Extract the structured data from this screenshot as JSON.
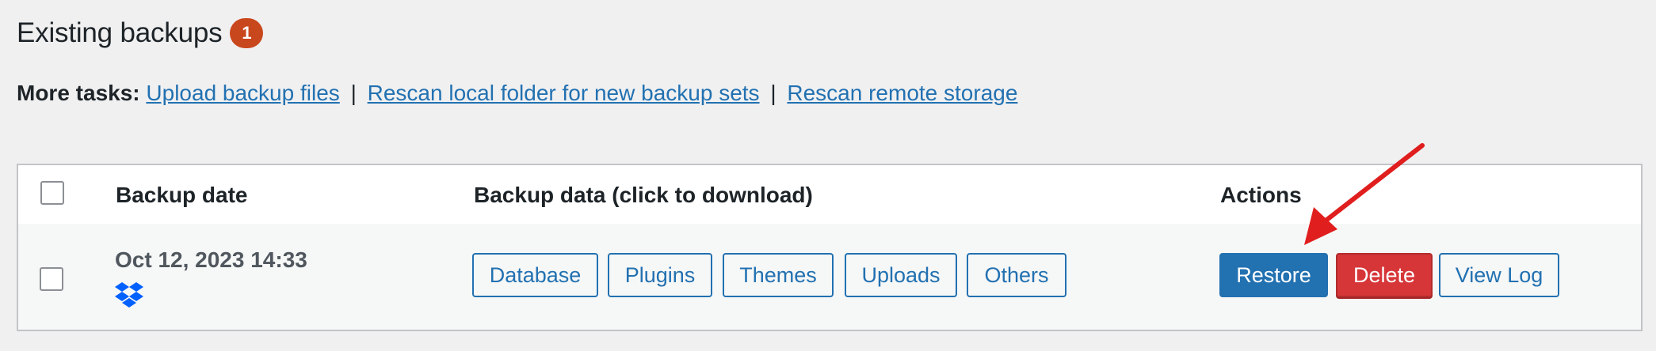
{
  "heading": {
    "title": "Existing backups",
    "count": "1"
  },
  "more_tasks": {
    "label": "More tasks:",
    "links": [
      "Upload backup files",
      "Rescan local folder for new backup sets",
      "Rescan remote storage"
    ],
    "separator": "|"
  },
  "table": {
    "columns": [
      "Backup date",
      "Backup data (click to download)",
      "Actions"
    ],
    "rows": [
      {
        "date": "Oct 12, 2023 14:33",
        "storage_icon": "dropbox-icon",
        "data_buttons": [
          "Database",
          "Plugins",
          "Themes",
          "Uploads",
          "Others"
        ],
        "actions": [
          "Restore",
          "Delete",
          "View Log"
        ]
      }
    ]
  },
  "colors": {
    "accent": "#2271b1",
    "danger": "#d63638",
    "badge": "#c9471c",
    "annotation_arrow": "#e01e1e"
  }
}
